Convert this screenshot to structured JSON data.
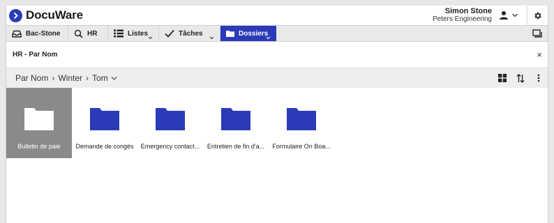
{
  "header": {
    "logo_text": "DocuWare",
    "user_name": "Simon Stone",
    "user_org": "Peters Engineering",
    "brand_color": "#2b3bb8"
  },
  "tabs": [
    {
      "label": "Bac-Stone",
      "icon": "tray-icon"
    },
    {
      "label": "HR",
      "icon": "search-icon"
    },
    {
      "label": "Listes",
      "icon": "list-icon"
    },
    {
      "label": "Tâches",
      "icon": "check-icon"
    },
    {
      "label": "Dossiers",
      "icon": "folder-icon",
      "active": true
    }
  ],
  "panel": {
    "title": "HR - Par Nom",
    "close_label": "×"
  },
  "breadcrumb": {
    "items": [
      "Par Nom",
      "Winter",
      "Tom"
    ],
    "separator": "›",
    "chevron": "⌄"
  },
  "folders": [
    {
      "label": "Bulletin de paie",
      "selected": true
    },
    {
      "label": "Demande de congés"
    },
    {
      "label": "Emergency contact..."
    },
    {
      "label": "Entretien de fin d'a..."
    },
    {
      "label": "Formulaire On Boa..."
    }
  ]
}
